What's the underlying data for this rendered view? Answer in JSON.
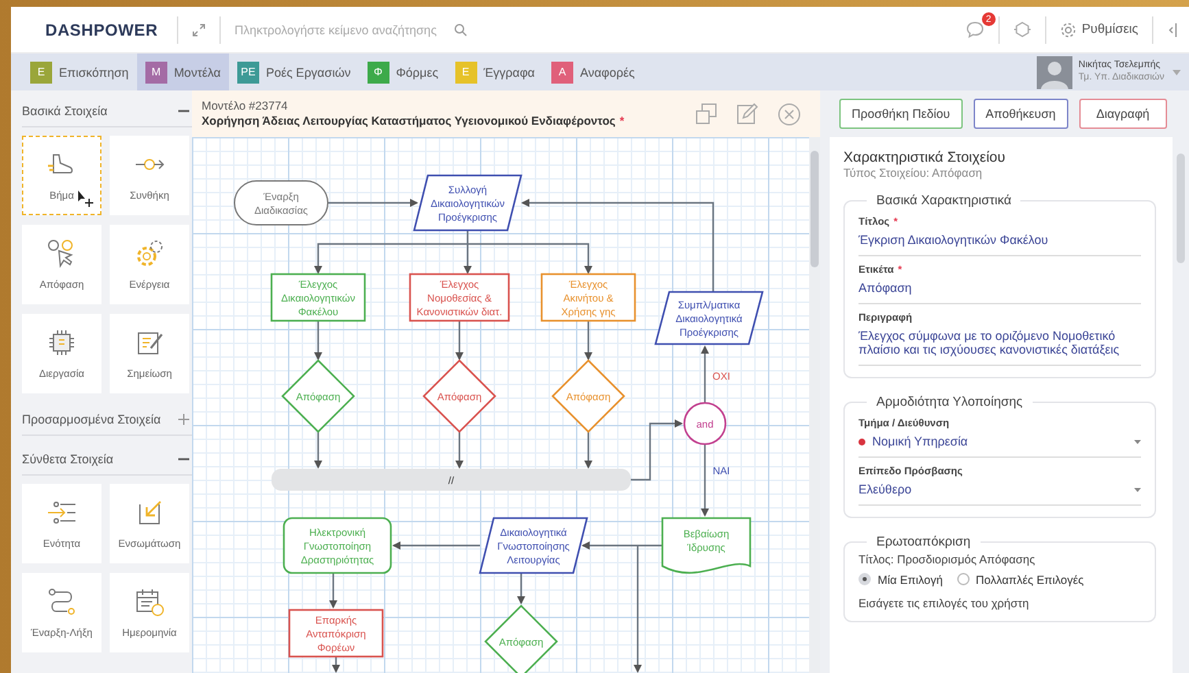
{
  "topbar": {
    "logo": "DASHPOWER",
    "search": {
      "placeholder": "Πληκτρολογήστε κείμενο αναζήτησης"
    },
    "notifications_badge": "2",
    "settings_label": "Ρυθμίσεις"
  },
  "nav_tabs": [
    {
      "letter": "Ε",
      "label": "Επισκόπηση",
      "color": "#9aa63a",
      "selected": false
    },
    {
      "letter": "Μ",
      "label": "Μοντέλα",
      "color": "#a46ba5",
      "selected": true
    },
    {
      "letter": "ΡΕ",
      "label": "Ροές Εργασιών",
      "color": "#3d9a96",
      "selected": false
    },
    {
      "letter": "Φ",
      "label": "Φόρμες",
      "color": "#3daa4a",
      "selected": false
    },
    {
      "letter": "Ε",
      "label": "Έγγραφα",
      "color": "#e6c229",
      "selected": false
    },
    {
      "letter": "Α",
      "label": "Αναφορές",
      "color": "#e0607a",
      "selected": false
    }
  ],
  "user": {
    "name": "Νικήτας Τσελεμπής",
    "department": "Τμ. Υπ. Διαδικασιών"
  },
  "sidebar": {
    "sections": [
      {
        "title": "Βασικά Στοιχεία",
        "expanded": true,
        "items": [
          {
            "label": "Βήμα",
            "selected": true
          },
          {
            "label": "Συνθήκη",
            "selected": false
          },
          {
            "label": "Απόφαση",
            "selected": false
          },
          {
            "label": "Ενέργεια",
            "selected": false
          },
          {
            "label": "Διεργασία",
            "selected": false
          },
          {
            "label": "Σημείωση",
            "selected": false
          }
        ]
      },
      {
        "title": "Προσαρμοσμένα Στοιχεία",
        "expanded": false
      },
      {
        "title": "Σύνθετα Στοιχεία",
        "expanded": true,
        "items": [
          {
            "label": "Ενότητα",
            "selected": false
          },
          {
            "label": "Ενσωμάτωση",
            "selected": false
          },
          {
            "label": "Έναρξη-Λήξη",
            "selected": false
          },
          {
            "label": "Ημερομηνία",
            "selected": false
          }
        ]
      }
    ]
  },
  "model": {
    "number": "Μοντέλο #23774",
    "title": "Χορήγηση Άδειας Λειτουργίας Καταστήματος Υγειονομικού Ενδιαφέροντος",
    "unsaved_mark": "*"
  },
  "diagram": {
    "nodes": [
      {
        "kind": "terminal",
        "color": "#777777",
        "lines": [
          "Έναρξη",
          "Διαδικασίας"
        ]
      },
      {
        "kind": "io",
        "color": "#3f4fb0",
        "lines": [
          "Συλλογή",
          "Δικαιολογητικών",
          "Προέγκρισης"
        ]
      },
      {
        "kind": "process",
        "color": "#4caf50",
        "lines": [
          "Έλεγχος",
          "Δικαιολογητικών",
          "Φακέλου"
        ]
      },
      {
        "kind": "process",
        "color": "#d9534f",
        "lines": [
          "Έλεγχος",
          "Νομοθεσίας &",
          "Κανονιστικών διατ."
        ]
      },
      {
        "kind": "process",
        "color": "#e8912d",
        "lines": [
          "Έλεγχος",
          "Ακινήτου &",
          "Χρήσης γης"
        ]
      },
      {
        "kind": "io",
        "color": "#3f4fb0",
        "lines": [
          "Συμπλ/ματικα",
          "Δικαιολογητικά",
          "Προέγκρισης"
        ]
      },
      {
        "kind": "decision",
        "color": "#4caf50",
        "lines": [
          "Απόφαση"
        ]
      },
      {
        "kind": "decision",
        "color": "#d9534f",
        "lines": [
          "Απόφαση"
        ]
      },
      {
        "kind": "decision",
        "color": "#e8912d",
        "lines": [
          "Απόφαση"
        ]
      },
      {
        "kind": "junction",
        "color": "#c2408f",
        "lines": [
          "and"
        ]
      },
      {
        "kind": "bar",
        "color": "#333333",
        "lines": [
          "//"
        ]
      },
      {
        "kind": "rounded",
        "color": "#4caf50",
        "lines": [
          "Ηλεκτρονική",
          "Γνωστοποίηση",
          "Δραστηριότητας"
        ]
      },
      {
        "kind": "io",
        "color": "#3f4fb0",
        "lines": [
          "Δικαιολογητικά",
          "Γνωστοποίησης",
          "Λειτουργίας"
        ]
      },
      {
        "kind": "document",
        "color": "#4caf50",
        "lines": [
          "Βεβαίωση",
          "Ίδρυσης"
        ]
      },
      {
        "kind": "process",
        "color": "#d9534f",
        "lines": [
          "Επαρκής",
          "Ανταπόκριση",
          "Φορέων"
        ]
      },
      {
        "kind": "decision",
        "color": "#4caf50",
        "lines": [
          "Απόφαση"
        ]
      }
    ],
    "edge_labels": [
      {
        "text": "ΟΧΙ",
        "color": "#d9534f"
      },
      {
        "text": "ΝΑΙ",
        "color": "#3f4fb0"
      }
    ]
  },
  "actions": [
    {
      "label": "Προσθήκη Πεδίου",
      "color": "#7cc47f"
    },
    {
      "label": "Αποθήκευση",
      "color": "#7d85c9"
    },
    {
      "label": "Διαγραφή",
      "color": "#e58c95"
    }
  ],
  "properties": {
    "title": "Χαρακτηριστικά Στοιχείου",
    "subtitle": "Τύπος Στοιχείου: Απόφαση",
    "groups": [
      {
        "legend": "Βασικά Χαρακτηριστικά",
        "fields": [
          {
            "kind": "text",
            "label": "Τίτλος",
            "required_mark": "*",
            "value": "Έγκριση Δικαιολογητικών Φακέλου"
          },
          {
            "kind": "text",
            "label": "Ετικέτα",
            "required_mark": "*",
            "value": "Απόφαση"
          },
          {
            "kind": "text",
            "label": "Περιγραφή",
            "value": "Έλεγχος σύμφωνα με το οριζόμενο Νομοθετικό πλαίσιο και τις ισχύουσες κανονιστικές διατάξεις"
          }
        ]
      },
      {
        "legend": "Αρμοδιότητα Υλοποίησης",
        "fields": [
          {
            "kind": "select",
            "label": "Τμήμα / Διεύθυνση",
            "value": "Νομική Υπηρεσία",
            "color": "#d8343f"
          },
          {
            "kind": "select",
            "label": "Επίπεδο Πρόσβασης",
            "value": "Ελεύθερο"
          }
        ]
      },
      {
        "legend": "Ερωτοαπόκριση",
        "fields": [
          {
            "kind": "note",
            "value": "Τίτλος: Προσδιορισμός Απόφασης"
          },
          {
            "kind": "radio",
            "options": [
              {
                "label": "Μία Επιλογή",
                "selected": true
              },
              {
                "label": "Πολλαπλές Επιλογές",
                "selected": false
              }
            ]
          },
          {
            "kind": "note",
            "value": "Εισάγετε τις επιλογές του χρήστη"
          }
        ]
      }
    ]
  }
}
